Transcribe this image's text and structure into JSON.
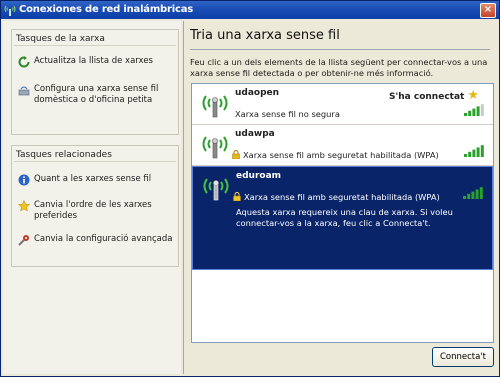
{
  "window": {
    "title": "Conexiones de red inalámbricas",
    "close_glyph": "×"
  },
  "sidebar": {
    "network_tasks": {
      "title": "Tasques de la xarxa",
      "items": [
        {
          "label": "Actualitza la llista de xarxes",
          "icon": "refresh-icon"
        },
        {
          "label": "Configura una xarxa sense fil domèstica o d'oficina petita",
          "icon": "wireless-setup-icon"
        }
      ]
    },
    "related_tasks": {
      "title": "Tasques relacionades",
      "items": [
        {
          "label": "Quant a les xarxes sense fil",
          "icon": "info-icon"
        },
        {
          "label": "Canvia l'ordre de les xarxes preferides",
          "icon": "star-icon"
        },
        {
          "label": "Canvia la configuració avançada",
          "icon": "settings-icon"
        }
      ]
    }
  },
  "main": {
    "heading": "Tria una xarxa sense fil",
    "description": "Feu clic a un dels elements de la llista següent per connectar-vos a una xarxa sense fil detectada o per obtenir-ne més informació.",
    "networks": [
      {
        "name": "udaopen",
        "status": "S'ha connectat",
        "security": "Xarxa sense fil no segura",
        "signal_bars": 4,
        "selected": false
      },
      {
        "name": "udawpa",
        "status": "",
        "security": "Xarxa sense fil amb seguretat habilitada (WPA)",
        "signal_bars": 5,
        "selected": false
      },
      {
        "name": "eduroam",
        "status": "",
        "security": "Xarxa sense fil amb seguretat habilitada (WPA)",
        "signal_bars": 5,
        "selected": true,
        "message": "Aquesta xarxa requereix una clau de xarxa. Si voleu connectar-vos a la xarxa, feu clic a Connecta't."
      }
    ],
    "connect_button": "Connecta't"
  },
  "colors": {
    "selection": "#0a246a",
    "signal": "#2ca02c",
    "title_bar": "#1a4db5"
  }
}
